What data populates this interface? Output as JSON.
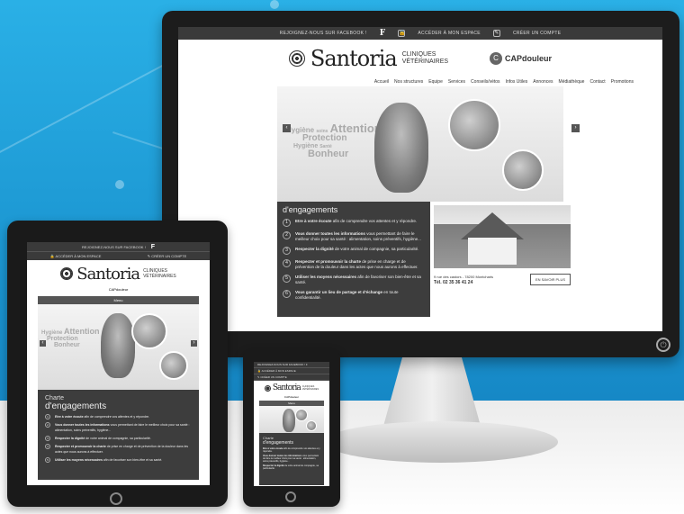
{
  "site": {
    "facebook_cta": "REJOIGNEZ-NOUS SUR FACEBOOK !",
    "facebook_icon": "f",
    "account_access": "ACCÉDER À MON ESPACE",
    "create_account": "CRÉER UN COMPTE",
    "brand": "Santoria",
    "brand_sub_line1": "CLINIQUES",
    "brand_sub_line2": "VÉTÉRINAIRES",
    "partner": "CAPdouleur",
    "partner_icon": "C",
    "nav": [
      "Accueil",
      "Nos structures",
      "Equipe",
      "Services",
      "Conseils/vétos",
      "Infos Utiles",
      "Annonces",
      "Médiathèque",
      "Contact",
      "Promotions"
    ],
    "menu_label": "Menu",
    "hero_words": [
      "Hygiène",
      "soins",
      "Attention",
      "Protection",
      "Bonheur",
      "Hygiène",
      "Santé",
      "Protection",
      "Bonheur",
      "Attention"
    ],
    "arrow_prev": "‹",
    "arrow_next": "›",
    "charter": {
      "title_line1": "Charte",
      "title_line2": "d'engagements",
      "items": [
        {
          "n": "1",
          "bold": "Etre à votre écoute",
          "rest": " afin de comprendre vos attentes et y répondre."
        },
        {
          "n": "2",
          "bold": "Vous donner toutes les informations",
          "rest": " vous permettant de faire le meilleur choix pour sa santé : alimentation, soins préventifs, hygiène..."
        },
        {
          "n": "3",
          "bold": "Respecter la dignité",
          "rest": " de votre animal de compagnie, sa particularité."
        },
        {
          "n": "4",
          "bold": "Respecter et promouvoir la charte",
          "rest": " de prise en charge et de prévention de la douleur dans les actes que nous aurons à effectuer."
        },
        {
          "n": "5",
          "bold": "Utiliser les moyens nécessaires",
          "rest": " afin de favoriser son bien-être et sa santé."
        },
        {
          "n": "6",
          "bold": "Vous garantir un lieu de partage et d'échange",
          "rest": " en toute confidentialité."
        }
      ]
    },
    "clinic": {
      "address_line1": "9 rue des castors - 78200 Montcharis",
      "phone": "Tél. 02 35 36 41 24",
      "more_button": "EN SAVOIR PLUS"
    }
  },
  "device_icons": {
    "lock": "🔒",
    "pencil": "✎",
    "power": "⏻"
  },
  "colors": {
    "background_blue": "#1f9ad2",
    "device_bezel": "#1c1c1c",
    "site_dark": "#3d3d3d"
  }
}
